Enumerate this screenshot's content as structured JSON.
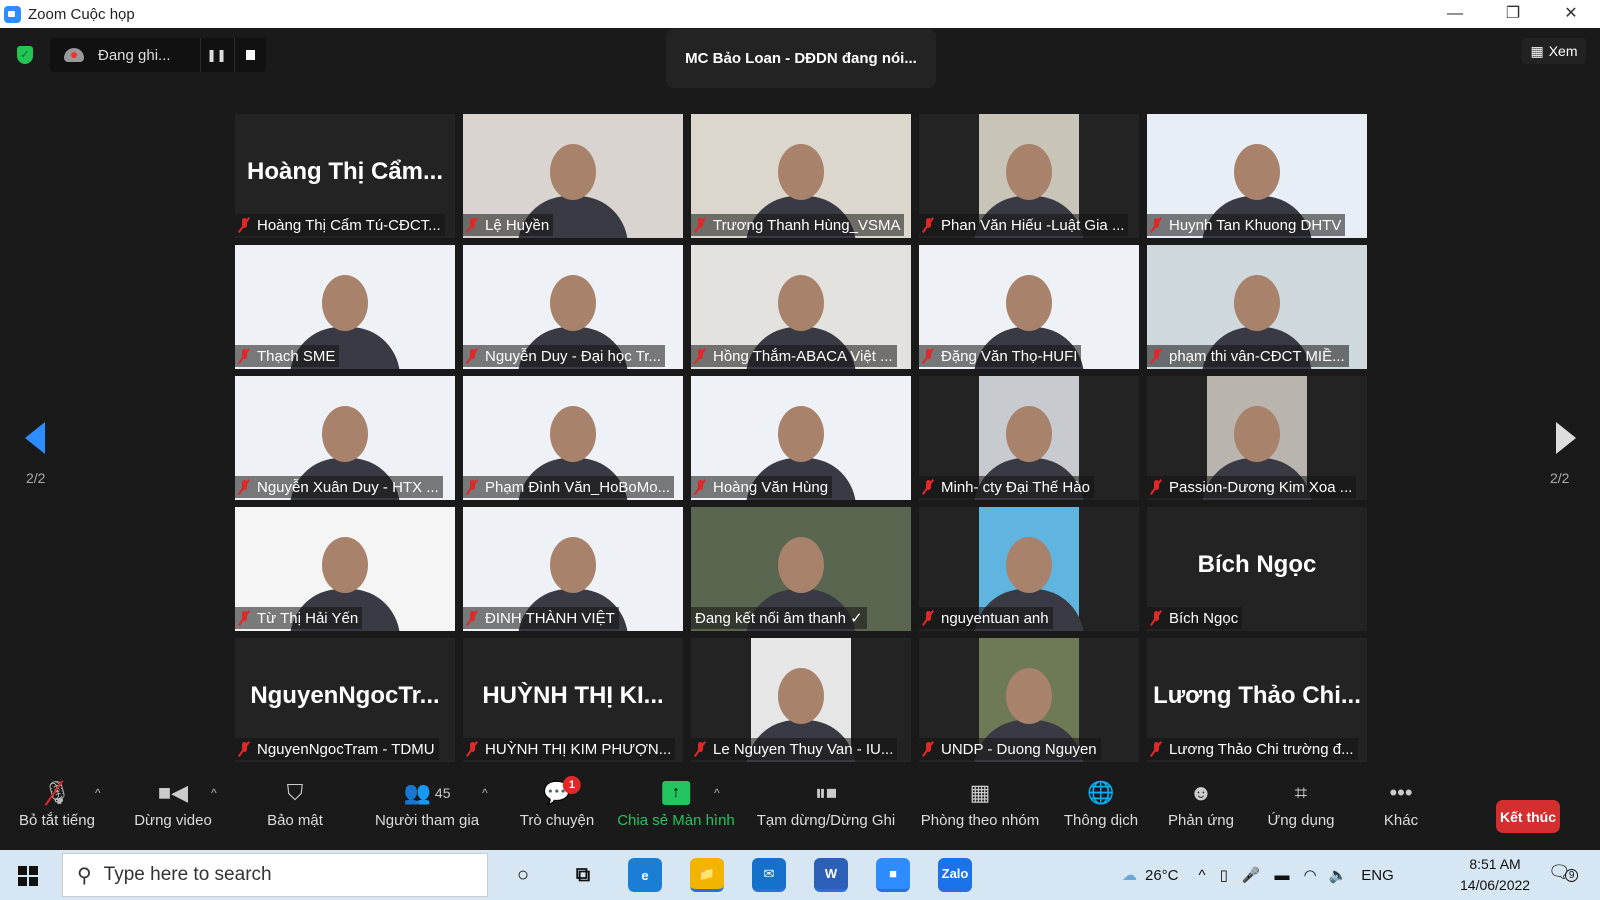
{
  "window": {
    "title": "Zoom Cuộc họp",
    "minimize": "—",
    "restore": "❐",
    "close": "✕"
  },
  "topbar": {
    "recording_label": "Đang ghi...",
    "pause_icon": "pause-icon",
    "stop_icon": "stop-icon",
    "active_speaker": "MC Bảo Loan - DĐDN đang nói...",
    "view_label": "Xem"
  },
  "pagination": {
    "left": "2/2",
    "right": "2/2"
  },
  "tiles": [
    {
      "kind": "name",
      "big": "Hoàng Thị Cẩm...",
      "label": "Hoàng Thị Cẩm Tú-CĐCT...",
      "muted": true,
      "bg": "#232323"
    },
    {
      "kind": "video",
      "label": "Lệ Huyền",
      "muted": true,
      "bg": "#d9d4cf"
    },
    {
      "kind": "video",
      "label": "Trương Thanh Hùng_VSMA",
      "muted": true,
      "bg": "#dcd7cc"
    },
    {
      "kind": "video",
      "label": "Phan Văn Hiếu -Luật Gia ...",
      "muted": true,
      "bg": "#c9c4b8",
      "narrow": true
    },
    {
      "kind": "video",
      "label": "Huynh Tan Khuong DHTV",
      "muted": true,
      "bg": "#e8eef5"
    },
    {
      "kind": "video",
      "label": "Thạch SME",
      "muted": true,
      "bg": "#eef2f7"
    },
    {
      "kind": "video",
      "label": "Nguyễn Duy -  Đại học Tr...",
      "muted": true,
      "bg": "#eef2f7"
    },
    {
      "kind": "video",
      "label": "Hồng Thắm-ABACA Việt ...",
      "muted": true,
      "bg": "#e4e2de"
    },
    {
      "kind": "video",
      "label": "Đặng Văn Thọ-HUFI",
      "muted": true,
      "bg": "#eef2f7"
    },
    {
      "kind": "video",
      "label": "phạm thi vân-CĐCT MIỀ...",
      "muted": true,
      "bg": "#cfd8dc"
    },
    {
      "kind": "video",
      "label": "Nguyễn Xuân Duy - HTX ...",
      "muted": true,
      "bg": "#eef2f7"
    },
    {
      "kind": "video",
      "label": "Phạm Đình Văn_HoBoMo...",
      "muted": true,
      "bg": "#eef2f7"
    },
    {
      "kind": "video",
      "label": "Hoàng Văn Hùng",
      "muted": true,
      "bg": "#eef2f7"
    },
    {
      "kind": "video",
      "label": "Minh- cty Đại Thế Hào",
      "muted": true,
      "bg": "#c7cbcf",
      "narrow": true
    },
    {
      "kind": "video",
      "label": "Passion-Dương Kim Xoa ...",
      "muted": true,
      "bg": "#b9b5ae",
      "narrow": true
    },
    {
      "kind": "video",
      "label": "Từ Thị Hải Yến",
      "muted": true,
      "bg": "#f5f5f5"
    },
    {
      "kind": "video",
      "label": "ĐINH THÀNH VIỆT",
      "muted": true,
      "bg": "#eef2f7"
    },
    {
      "kind": "video",
      "label": "Đang kết nối âm thanh ✓",
      "muted": false,
      "bg": "#5b6650"
    },
    {
      "kind": "video",
      "label": "nguyentuan anh",
      "muted": true,
      "bg": "#5fb4e0",
      "narrow": true
    },
    {
      "kind": "name",
      "big": "Bích Ngọc",
      "label": "Bích Ngọc",
      "muted": true,
      "bg": "#232323"
    },
    {
      "kind": "name",
      "big": "NguyenNgocTr...",
      "label": "NguyenNgocTram - TDMU",
      "muted": true,
      "bg": "#232323"
    },
    {
      "kind": "name",
      "big": "HUỲNH THỊ KI...",
      "label": "HUỲNH THỊ KIM PHƯỢN...",
      "muted": true,
      "bg": "#232323"
    },
    {
      "kind": "video",
      "label": "Le Nguyen Thuy Van - IU...",
      "muted": true,
      "bg": "#e6e6e6",
      "narrow": true
    },
    {
      "kind": "video",
      "label": "UNDP - Duong Nguyen",
      "muted": true,
      "bg": "#6d7a55",
      "narrow": true
    },
    {
      "kind": "name",
      "big": "Lương Thảo Chi...",
      "label": "Lương Thảo Chi trường đ...",
      "muted": true,
      "bg": "#232323"
    }
  ],
  "toolbar": {
    "items": [
      {
        "label": "Bỏ tắt tiếng",
        "icon": "mic-muted-icon",
        "glyph": "🎙",
        "caret": true
      },
      {
        "label": "Dừng video",
        "icon": "video-camera-icon",
        "glyph": "■◀",
        "caret": true
      },
      {
        "label": "Bảo mật",
        "icon": "shield-icon",
        "glyph": "⛉",
        "caret": false
      },
      {
        "label": "Người tham gia",
        "icon": "participants-icon",
        "glyph": "👥",
        "count": "45",
        "caret": true
      },
      {
        "label": "Trò chuyện",
        "icon": "chat-icon",
        "glyph": "💬",
        "badge": "1",
        "caret": false
      },
      {
        "label": "Chia sẻ Màn hình",
        "icon": "share-screen-icon",
        "glyph": "↑",
        "caret": true
      },
      {
        "label": "Tạm dừng/Dừng Ghi",
        "icon": "pause-stop-recording-icon",
        "glyph": "⏸⏹",
        "caret": false
      },
      {
        "label": "Phòng theo nhóm",
        "icon": "breakout-rooms-icon",
        "glyph": "▦",
        "caret": false
      },
      {
        "label": "Thông dịch",
        "icon": "globe-icon",
        "glyph": "🌐",
        "caret": false
      },
      {
        "label": "Phản ứng",
        "icon": "reaction-icon",
        "glyph": "☻",
        "caret": false
      },
      {
        "label": "Ứng dụng",
        "icon": "apps-icon",
        "glyph": "⌗",
        "caret": false
      },
      {
        "label": "Khác",
        "icon": "more-icon",
        "glyph": "•••",
        "caret": false
      }
    ],
    "end_label": "Kết thúc"
  },
  "taskbar": {
    "search_placeholder": "Type here to search",
    "apps": [
      {
        "name": "cortana",
        "glyph": "○"
      },
      {
        "name": "task-view",
        "glyph": "⧉"
      },
      {
        "name": "edge",
        "glyph": "e"
      },
      {
        "name": "file-explorer",
        "glyph": "📁"
      },
      {
        "name": "mail",
        "glyph": "✉"
      },
      {
        "name": "word",
        "glyph": "W"
      },
      {
        "name": "zoom",
        "glyph": "■"
      },
      {
        "name": "zalo",
        "glyph": "Zalo"
      }
    ],
    "weather": "26°C",
    "language": "ENG",
    "time": "8:51 AM",
    "date": "14/06/2022",
    "notifications": "9"
  },
  "colors": {
    "accent": "#2d8cff",
    "share_green": "#22c55e",
    "end_red": "#d32f2f",
    "mute_red": "#e02828"
  }
}
